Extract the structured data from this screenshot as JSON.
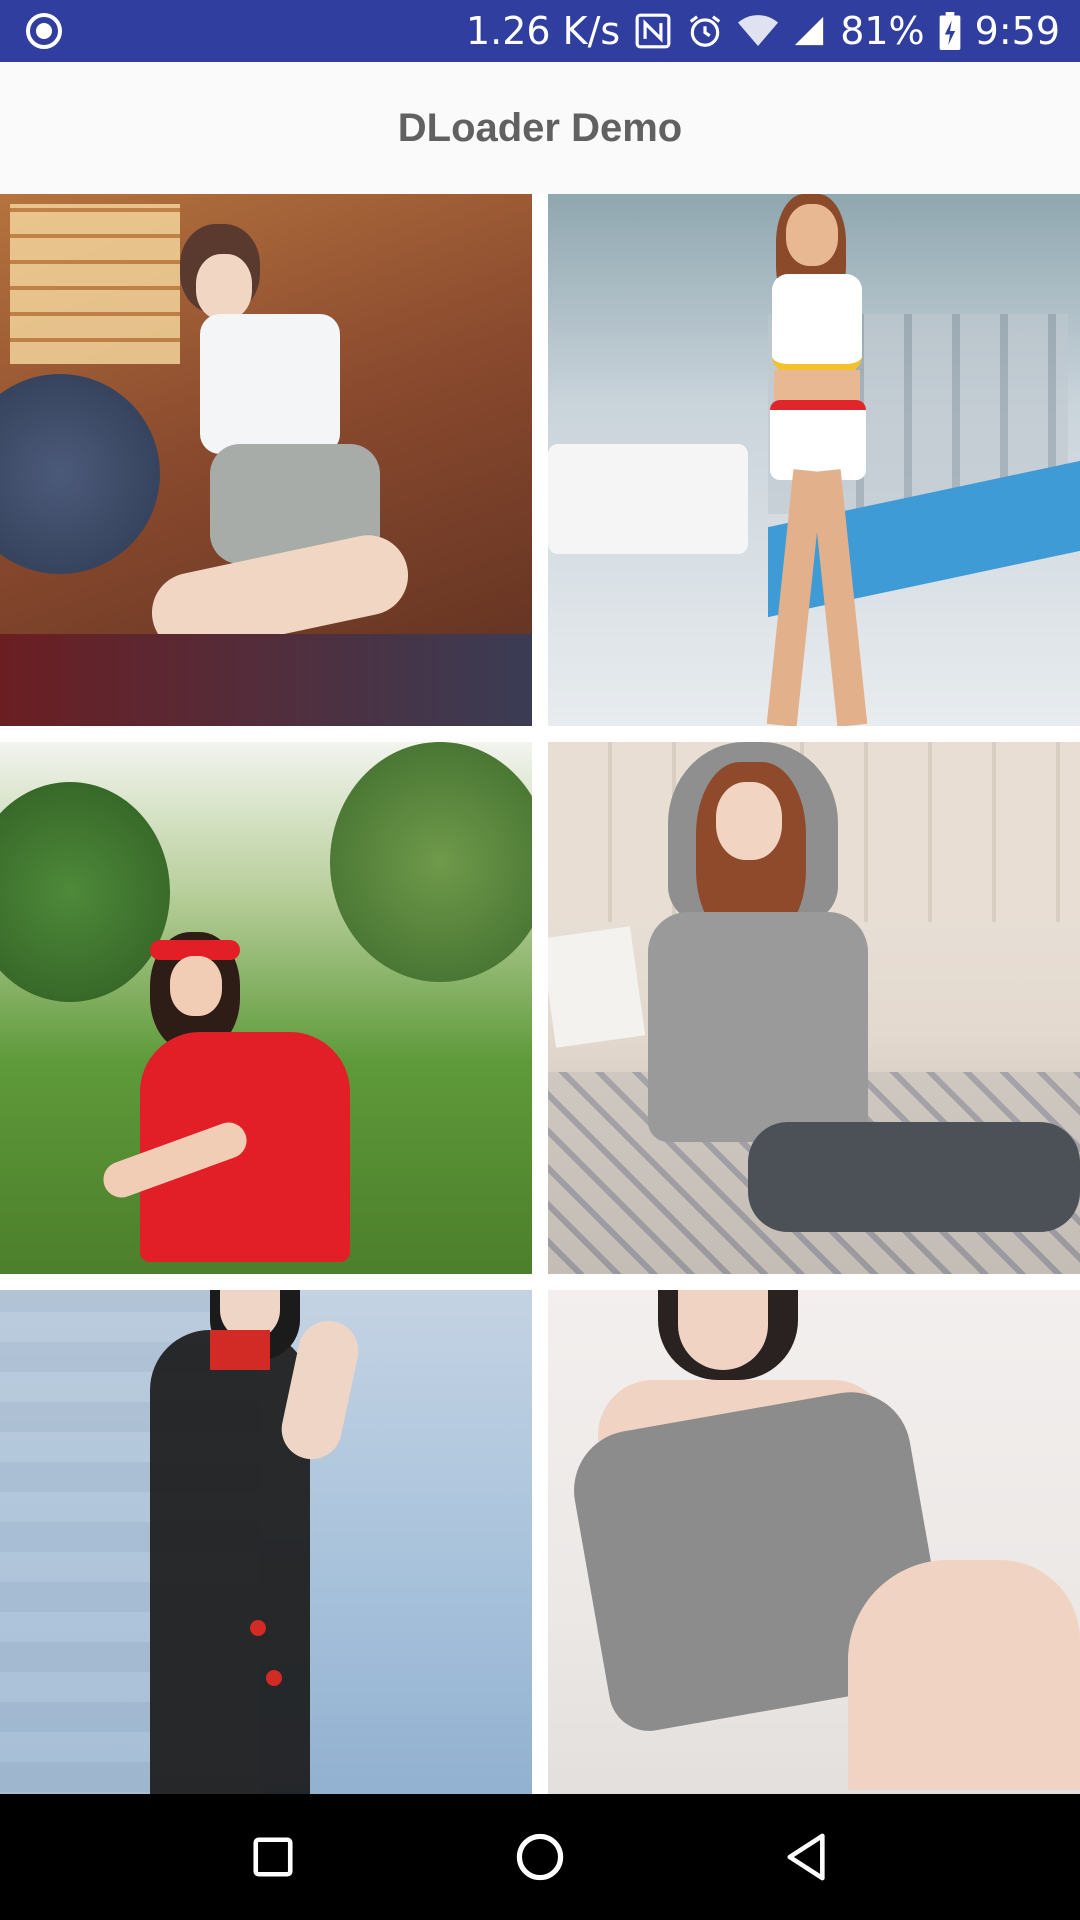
{
  "status_bar": {
    "net_speed": "1.26 K/s",
    "battery": "81%",
    "time": "9:59",
    "icons": [
      "notification-icon",
      "nfc-icon",
      "alarm-icon",
      "wifi-icon",
      "signal-icon",
      "battery-icon"
    ]
  },
  "app_bar": {
    "title": "DLoader Demo"
  },
  "images": [
    {
      "name": "photo-1",
      "colors": {
        "bg": "#8A4A2E",
        "accent": "#DCE3EC",
        "skin": "#F2D6C4"
      }
    },
    {
      "name": "photo-2",
      "colors": {
        "bg": "#C9D3DA",
        "accent": "#FFFFFF",
        "skin": "#E8B892"
      }
    },
    {
      "name": "photo-3",
      "colors": {
        "bg": "#5E9A3A",
        "accent": "#E21E26",
        "skin": "#F1CDB6"
      }
    },
    {
      "name": "photo-4",
      "colors": {
        "bg": "#E7DFD6",
        "accent": "#9A9A9A",
        "skin": "#F2D4C2"
      }
    },
    {
      "name": "photo-5",
      "colors": {
        "bg": "#A9C3DC",
        "accent": "#1B1B1B",
        "skin": "#EFD5C6"
      }
    },
    {
      "name": "photo-6",
      "colors": {
        "bg": "#ECE8E6",
        "accent": "#8C8C8C",
        "skin": "#F0D3C3"
      }
    }
  ],
  "nav_bar": {
    "buttons": [
      "recents-button",
      "home-button",
      "back-button"
    ]
  }
}
